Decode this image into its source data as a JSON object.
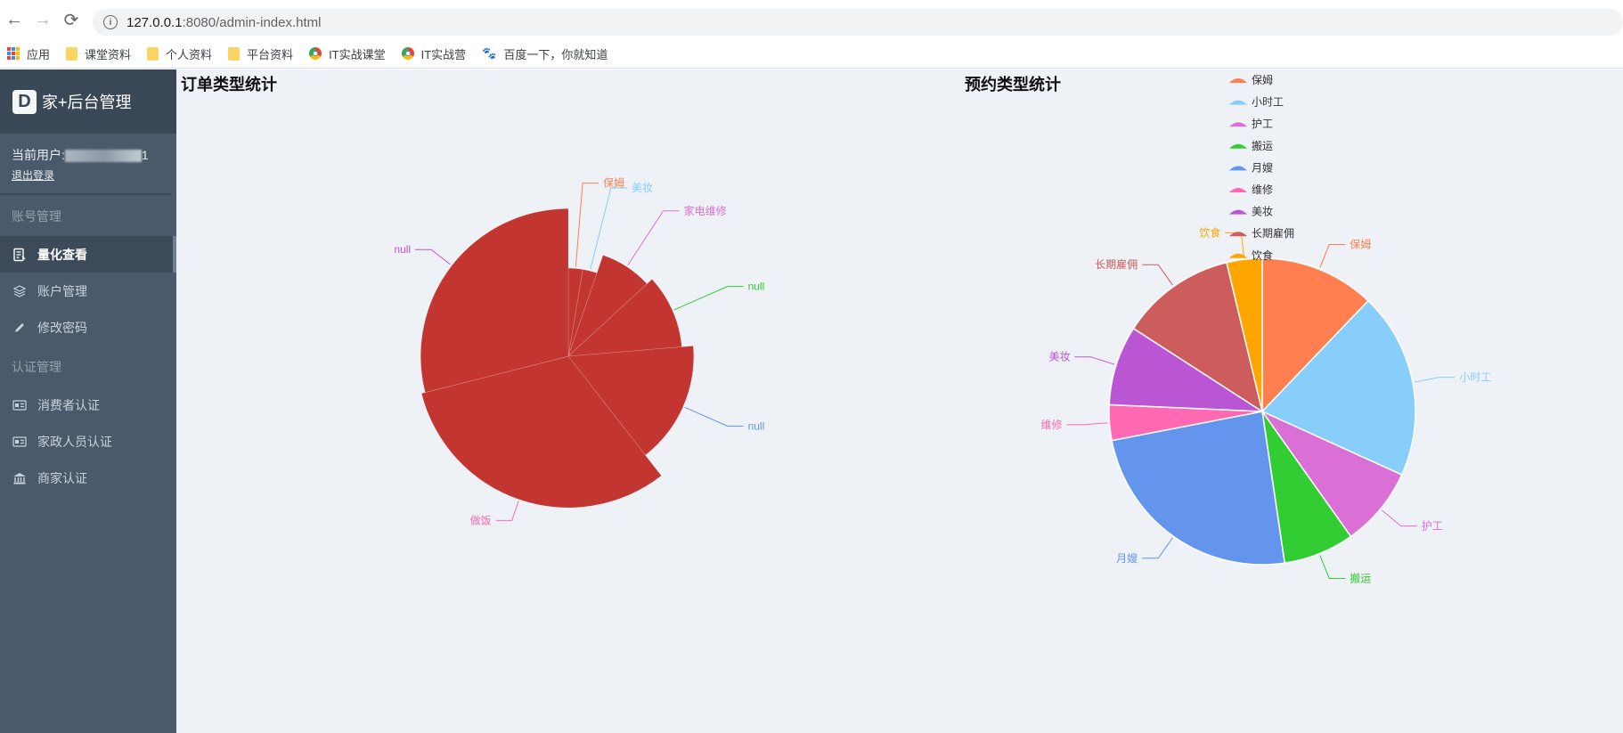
{
  "browser": {
    "url_host": "127.0.0.1",
    "url_rest": ":8080/admin-index.html",
    "bookmarks": [
      {
        "label": "应用",
        "icon": "apps-grid-icon"
      },
      {
        "label": "课堂资料",
        "icon": "folder-icon"
      },
      {
        "label": "个人资料",
        "icon": "folder-icon"
      },
      {
        "label": "平台资料",
        "icon": "folder-icon"
      },
      {
        "label": "IT实战课堂",
        "icon": "chrome-icon"
      },
      {
        "label": "IT实战营",
        "icon": "chrome-icon"
      },
      {
        "label": "百度一下，你就知道",
        "icon": "baidu-paw-icon"
      }
    ]
  },
  "sidebar": {
    "logo_letter": "D",
    "brand": "家+后台管理",
    "user_prefix": "当前用户:",
    "user_suffix": "1",
    "logout": "退出登录",
    "section_account": "账号管理",
    "section_auth": "认证管理",
    "items": [
      {
        "label": "量化查看",
        "icon": "report-icon",
        "active": true
      },
      {
        "label": "账户管理",
        "icon": "layers-icon",
        "active": false
      },
      {
        "label": "修改密码",
        "icon": "pencil-icon",
        "active": false
      },
      {
        "label": "消费者认证",
        "icon": "id-card-icon",
        "active": false
      },
      {
        "label": "家政人员认证",
        "icon": "id-card-icon",
        "active": false
      },
      {
        "label": "商家认证",
        "icon": "bank-icon",
        "active": false
      }
    ]
  },
  "charts": {
    "left_title": "订单类型统计",
    "right_title": "预约类型统计"
  },
  "chart_data": [
    {
      "type": "pie",
      "variant": "nightingale-rose",
      "title": "订单类型统计",
      "categories": [
        "保姆",
        "美妆",
        "家电维修",
        "null",
        "null",
        "做饭",
        "null"
      ],
      "values": [
        1,
        1,
        3,
        4,
        6,
        12,
        11
      ],
      "colors": [
        "#c23531"
      ],
      "label_colors": [
        "#ff7f50",
        "#87cefa",
        "#da70d6",
        "#32cd32",
        "#6495ed",
        "#ff69b4",
        "#ba55d3"
      ]
    },
    {
      "type": "pie",
      "title": "预约类型统计",
      "categories": [
        "保姆",
        "小时工",
        "护工",
        "搬运",
        "月嫂",
        "维修",
        "美妆",
        "长期雇佣",
        "饮食"
      ],
      "values": [
        13,
        21,
        9,
        8,
        26,
        4,
        9,
        13,
        4
      ],
      "colors": [
        "#ff7f50",
        "#87cefa",
        "#da70d6",
        "#32cd32",
        "#6495ed",
        "#ff69b4",
        "#ba55d3",
        "#cd5c5c",
        "#ffa500"
      ],
      "legend": {
        "position": "top"
      }
    }
  ]
}
